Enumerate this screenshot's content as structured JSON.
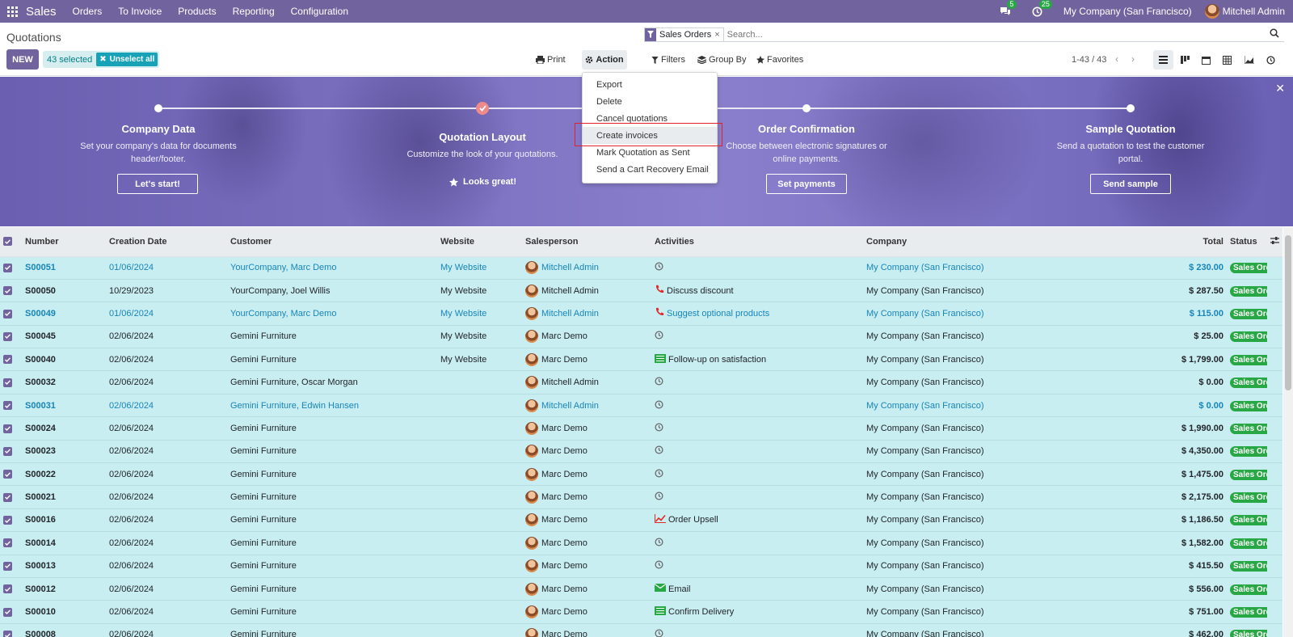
{
  "nav": {
    "app_name": "Sales",
    "menu": [
      "Orders",
      "To Invoice",
      "Products",
      "Reporting",
      "Configuration"
    ],
    "messages_badge": "5",
    "activities_badge": "25",
    "company": "My Company (San Francisco)",
    "user": "Mitchell Admin"
  },
  "control": {
    "title": "Quotations",
    "new_label": "NEW",
    "selected_label": "43 selected",
    "unselect_label": "Unselect all",
    "facet_label": "Sales Orders",
    "search_placeholder": "Search...",
    "print_label": "Print",
    "action_label": "Action",
    "filters_label": "Filters",
    "groupby_label": "Group By",
    "favorites_label": "Favorites",
    "pager": "1-43 / 43"
  },
  "dropdown": {
    "items": [
      "Export",
      "Delete",
      "Cancel quotations",
      "Create invoices",
      "Mark Quotation as Sent",
      "Send a Cart Recovery Email"
    ],
    "highlighted_index": 3
  },
  "banner": {
    "steps": [
      {
        "title": "Company Data",
        "desc1": "Set your company's data for documents",
        "desc2": "header/footer.",
        "button": "Let's start!"
      },
      {
        "title": "Quotation Layout",
        "desc1": "Customize the look of your quotations.",
        "desc2": "",
        "done_label": "Looks great!"
      },
      {
        "title": "Order Confirmation",
        "desc1": "Choose between electronic signatures or",
        "desc2": "online payments.",
        "button": "Set payments"
      },
      {
        "title": "Sample Quotation",
        "desc1": "Send a quotation to test the customer",
        "desc2": "portal.",
        "button": "Send sample"
      }
    ]
  },
  "table": {
    "headers": [
      "Number",
      "Creation Date",
      "Customer",
      "Website",
      "Salesperson",
      "Activities",
      "Company",
      "Total",
      "Status"
    ],
    "rows": [
      {
        "number": "S00051",
        "date": "01/06/2024",
        "customer": "YourCompany, Marc Demo",
        "website": "My Website",
        "salesperson": "Mitchell Admin",
        "activity": "",
        "activity_icon": "clock-icon",
        "company": "My Company (San Francisco)",
        "total": "$ 230.00",
        "status": "Sales Order",
        "link": true
      },
      {
        "number": "S00050",
        "date": "10/29/2023",
        "customer": "YourCompany, Joel Willis",
        "website": "My Website",
        "salesperson": "Mitchell Admin",
        "activity": "Discuss discount",
        "activity_icon": "phone-icon",
        "company": "My Company (San Francisco)",
        "total": "$ 287.50",
        "status": "Sales Order",
        "link": false
      },
      {
        "number": "S00049",
        "date": "01/06/2024",
        "customer": "YourCompany, Marc Demo",
        "website": "My Website",
        "salesperson": "Mitchell Admin",
        "activity": "Suggest optional products",
        "activity_icon": "phone-icon",
        "company": "My Company (San Francisco)",
        "total": "$ 115.00",
        "status": "Sales Order",
        "link": true
      },
      {
        "number": "S00045",
        "date": "02/06/2024",
        "customer": "Gemini Furniture",
        "website": "My Website",
        "salesperson": "Marc Demo",
        "activity": "",
        "activity_icon": "clock-icon",
        "company": "My Company (San Francisco)",
        "total": "$ 25.00",
        "status": "Sales Order",
        "link": false
      },
      {
        "number": "S00040",
        "date": "02/06/2024",
        "customer": "Gemini Furniture",
        "website": "My Website",
        "salesperson": "Marc Demo",
        "activity": "Follow-up on satisfaction",
        "activity_icon": "todo-icon",
        "company": "My Company (San Francisco)",
        "total": "$ 1,799.00",
        "status": "Sales Order",
        "link": false
      },
      {
        "number": "S00032",
        "date": "02/06/2024",
        "customer": "Gemini Furniture, Oscar Morgan",
        "website": "",
        "salesperson": "Mitchell Admin",
        "activity": "",
        "activity_icon": "clock-icon",
        "company": "My Company (San Francisco)",
        "total": "$ 0.00",
        "status": "Sales Order",
        "link": false
      },
      {
        "number": "S00031",
        "date": "02/06/2024",
        "customer": "Gemini Furniture, Edwin Hansen",
        "website": "",
        "salesperson": "Mitchell Admin",
        "activity": "",
        "activity_icon": "clock-icon",
        "company": "My Company (San Francisco)",
        "total": "$ 0.00",
        "status": "Sales Order",
        "link": true
      },
      {
        "number": "S00024",
        "date": "02/06/2024",
        "customer": "Gemini Furniture",
        "website": "",
        "salesperson": "Marc Demo",
        "activity": "",
        "activity_icon": "clock-icon",
        "company": "My Company (San Francisco)",
        "total": "$ 1,990.00",
        "status": "Sales Order",
        "link": false
      },
      {
        "number": "S00023",
        "date": "02/06/2024",
        "customer": "Gemini Furniture",
        "website": "",
        "salesperson": "Marc Demo",
        "activity": "",
        "activity_icon": "clock-icon",
        "company": "My Company (San Francisco)",
        "total": "$ 4,350.00",
        "status": "Sales Order",
        "link": false
      },
      {
        "number": "S00022",
        "date": "02/06/2024",
        "customer": "Gemini Furniture",
        "website": "",
        "salesperson": "Marc Demo",
        "activity": "",
        "activity_icon": "clock-icon",
        "company": "My Company (San Francisco)",
        "total": "$ 1,475.00",
        "status": "Sales Order",
        "link": false
      },
      {
        "number": "S00021",
        "date": "02/06/2024",
        "customer": "Gemini Furniture",
        "website": "",
        "salesperson": "Marc Demo",
        "activity": "",
        "activity_icon": "clock-icon",
        "company": "My Company (San Francisco)",
        "total": "$ 2,175.00",
        "status": "Sales Order",
        "link": false
      },
      {
        "number": "S00016",
        "date": "02/06/2024",
        "customer": "Gemini Furniture",
        "website": "",
        "salesperson": "Marc Demo",
        "activity": "Order Upsell",
        "activity_icon": "chart-icon",
        "company": "My Company (San Francisco)",
        "total": "$ 1,186.50",
        "status": "Sales Order",
        "link": false
      },
      {
        "number": "S00014",
        "date": "02/06/2024",
        "customer": "Gemini Furniture",
        "website": "",
        "salesperson": "Marc Demo",
        "activity": "",
        "activity_icon": "clock-icon",
        "company": "My Company (San Francisco)",
        "total": "$ 1,582.00",
        "status": "Sales Order",
        "link": false
      },
      {
        "number": "S00013",
        "date": "02/06/2024",
        "customer": "Gemini Furniture",
        "website": "",
        "salesperson": "Marc Demo",
        "activity": "",
        "activity_icon": "clock-icon",
        "company": "My Company (San Francisco)",
        "total": "$ 415.50",
        "status": "Sales Order",
        "link": false
      },
      {
        "number": "S00012",
        "date": "02/06/2024",
        "customer": "Gemini Furniture",
        "website": "",
        "salesperson": "Marc Demo",
        "activity": "Email",
        "activity_icon": "email-icon",
        "company": "My Company (San Francisco)",
        "total": "$ 556.00",
        "status": "Sales Order",
        "link": false
      },
      {
        "number": "S00010",
        "date": "02/06/2024",
        "customer": "Gemini Furniture",
        "website": "",
        "salesperson": "Marc Demo",
        "activity": "Confirm Delivery",
        "activity_icon": "todo-icon",
        "company": "My Company (San Francisco)",
        "total": "$ 751.00",
        "status": "Sales Order",
        "link": false
      },
      {
        "number": "S00008",
        "date": "02/06/2024",
        "customer": "Gemini Furniture",
        "website": "",
        "salesperson": "Marc Demo",
        "activity": "",
        "activity_icon": "clock-icon",
        "company": "My Company (San Francisco)",
        "total": "$ 462.00",
        "status": "Sales Order",
        "link": false
      }
    ]
  },
  "colors": {
    "brand": "#71639e",
    "link": "#1784b8",
    "status_green": "#28a745",
    "row_selected": "#c9eef2"
  }
}
